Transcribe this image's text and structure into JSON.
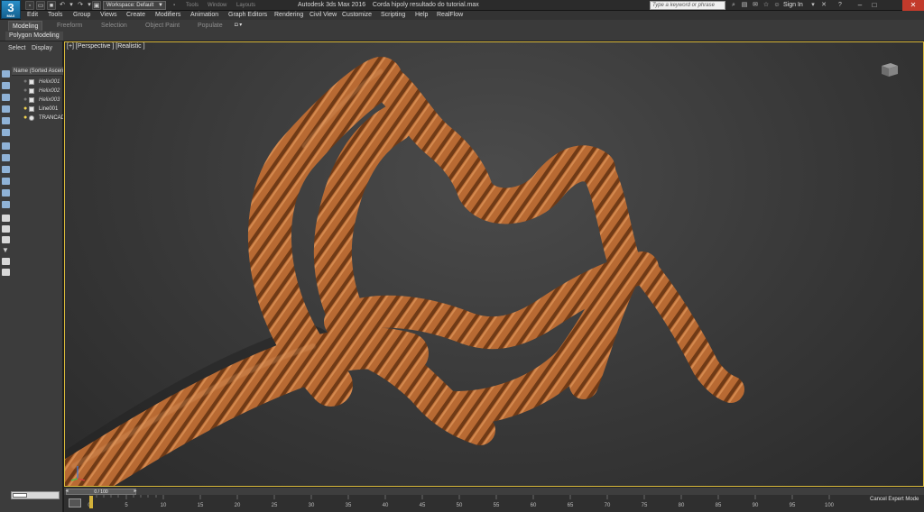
{
  "app": {
    "logo_top": "3",
    "logo_bottom": "MAX",
    "title": "Autodesk 3ds Max 2016",
    "file": "Corda hipoly resultado do tutorial.max",
    "workspace": "Workspace: Default",
    "search_placeholder": "Type a keyword or phrase",
    "signin": "Sign In",
    "faded_toolbar_text": [
      "Tools",
      "Window",
      "Layouts"
    ]
  },
  "menu": [
    "Edit",
    "Tools",
    "Group",
    "Views",
    "Create",
    "Modifiers",
    "Animation",
    "Graph Editors",
    "Rendering",
    "Civil View",
    "Customize",
    "Scripting",
    "Help",
    "RealFlow"
  ],
  "ribbon": {
    "tabs": [
      "Modeling",
      "Freeform",
      "Selection",
      "Object Paint",
      "Populate"
    ],
    "active_tab": "Modeling",
    "panel": "Polygon Modeling"
  },
  "explorer": {
    "tabs": [
      "Select",
      "Display"
    ],
    "header": "Name (Sorted Ascen",
    "rows": [
      {
        "name": "Helix001",
        "italic": true
      },
      {
        "name": "Helix002",
        "italic": true
      },
      {
        "name": "Helix003",
        "italic": true
      },
      {
        "name": "Line001",
        "italic": false
      },
      {
        "name": "TRANCAD",
        "italic": false
      }
    ]
  },
  "viewport": {
    "label": "[+] [Perspective ] [Realistic ]",
    "rope_color": "#b86a33"
  },
  "timeline": {
    "frame": "0 / 100",
    "ticks": [
      "0",
      "5",
      "10",
      "15",
      "20",
      "25",
      "30",
      "35",
      "40",
      "45",
      "50",
      "55",
      "60",
      "65",
      "70",
      "75",
      "80",
      "85",
      "90",
      "95",
      "100"
    ]
  },
  "status": {
    "cancel_expert": "Cancel Expert Mode"
  },
  "colors": {
    "accent_yellow": "#d9b93b",
    "close_red": "#c23a2b"
  }
}
